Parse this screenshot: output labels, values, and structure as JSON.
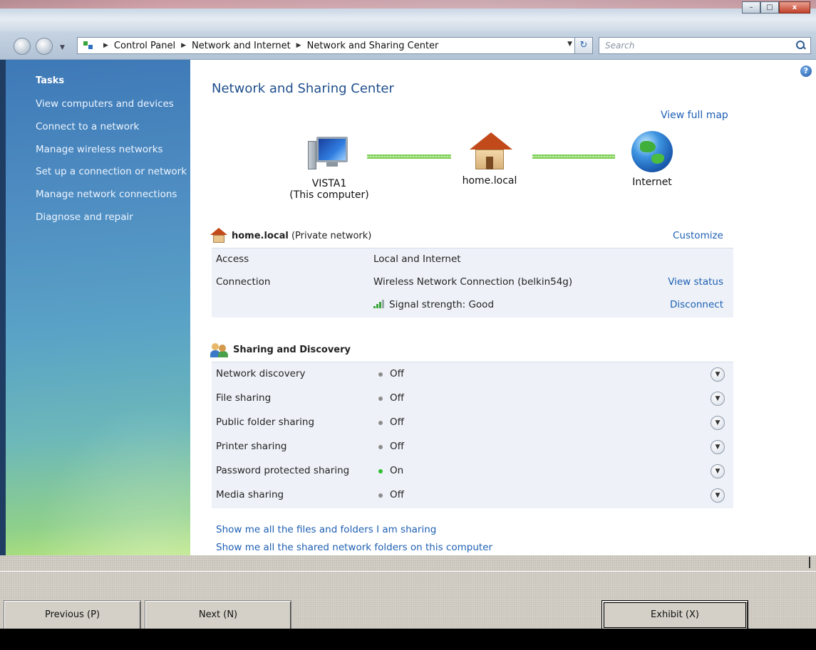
{
  "window": {
    "controls": [
      "minimize",
      "maximize",
      "close"
    ]
  },
  "address": {
    "crumbs": [
      "Control Panel",
      "Network and Internet",
      "Network and Sharing Center"
    ],
    "search_placeholder": "Search"
  },
  "sidebar": {
    "title": "Tasks",
    "links": [
      "View computers and devices",
      "Connect to a network",
      "Manage wireless networks",
      "Set up a connection or network",
      "Manage network connections",
      "Diagnose and repair"
    ]
  },
  "main": {
    "help": "?",
    "title": "Network and Sharing Center",
    "view_full_map": "View full map",
    "map": {
      "computer_name": "VISTA1",
      "computer_sub": "(This computer)",
      "network": "home.local",
      "internet": "Internet"
    },
    "network_section": {
      "name": "home.local",
      "type": "(Private network)",
      "customize": "Customize",
      "access_label": "Access",
      "access_value": "Local and Internet",
      "connection_label": "Connection",
      "connection_value": "Wireless Network Connection (belkin54g)",
      "view_status": "View status",
      "signal": "Signal strength:  Good",
      "disconnect": "Disconnect"
    },
    "sharing": {
      "title": "Sharing and Discovery",
      "items": [
        {
          "label": "Network discovery",
          "value": "Off",
          "on": false
        },
        {
          "label": "File sharing",
          "value": "Off",
          "on": false
        },
        {
          "label": "Public folder sharing",
          "value": "Off",
          "on": false
        },
        {
          "label": "Printer sharing",
          "value": "Off",
          "on": false
        },
        {
          "label": "Password protected sharing",
          "value": "On",
          "on": true
        },
        {
          "label": "Media sharing",
          "value": "Off",
          "on": false
        }
      ]
    },
    "links": [
      "Show me all the files and folders I am sharing",
      "Show me all the shared network folders on this computer"
    ]
  },
  "wizard": {
    "previous": "Previous (P)",
    "next": "Next (N)",
    "exhibit": "Exhibit (X)"
  },
  "colors": {
    "link": "#1d5fb3",
    "title": "#1f4e8c",
    "on_dot": "#2fbf2f",
    "off_dot": "#8c8c8c"
  }
}
